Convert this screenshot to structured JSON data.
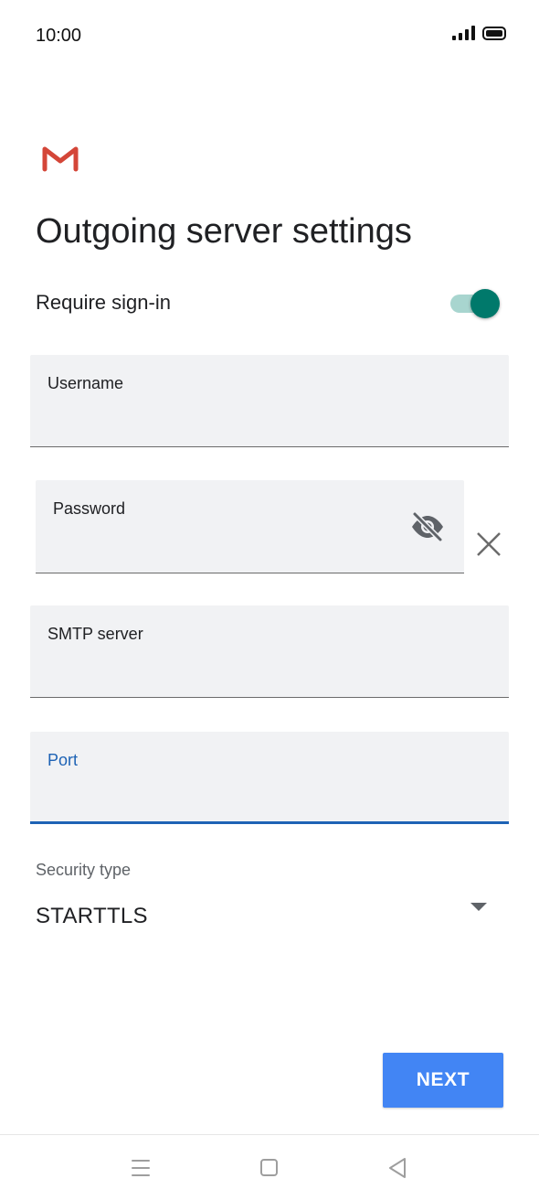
{
  "status_bar": {
    "time": "10:00",
    "icons": [
      "signal-icon",
      "battery-icon"
    ]
  },
  "app": {
    "logo_icon": "gmail-logo-icon",
    "brand_color": "#d44638"
  },
  "page": {
    "title": "Outgoing server settings"
  },
  "require_signin": {
    "label": "Require sign-in",
    "enabled": true,
    "accent_color": "#00796b"
  },
  "fields": {
    "username": {
      "label": "Username",
      "value": ""
    },
    "password": {
      "label": "Password",
      "value": "",
      "visibility_icon": "eye-off-icon",
      "clear_icon": "close-icon"
    },
    "smtp_server": {
      "label": "SMTP server",
      "value": ""
    },
    "port": {
      "label": "Port",
      "value": "",
      "focused": true,
      "focus_color": "#1e63b5"
    }
  },
  "security": {
    "label": "Security type",
    "selected": "STARTTLS"
  },
  "actions": {
    "next_label": "NEXT",
    "next_color": "#4285f4"
  },
  "nav_bar": {
    "icons": [
      "menu-icon",
      "home-icon",
      "back-icon"
    ]
  }
}
